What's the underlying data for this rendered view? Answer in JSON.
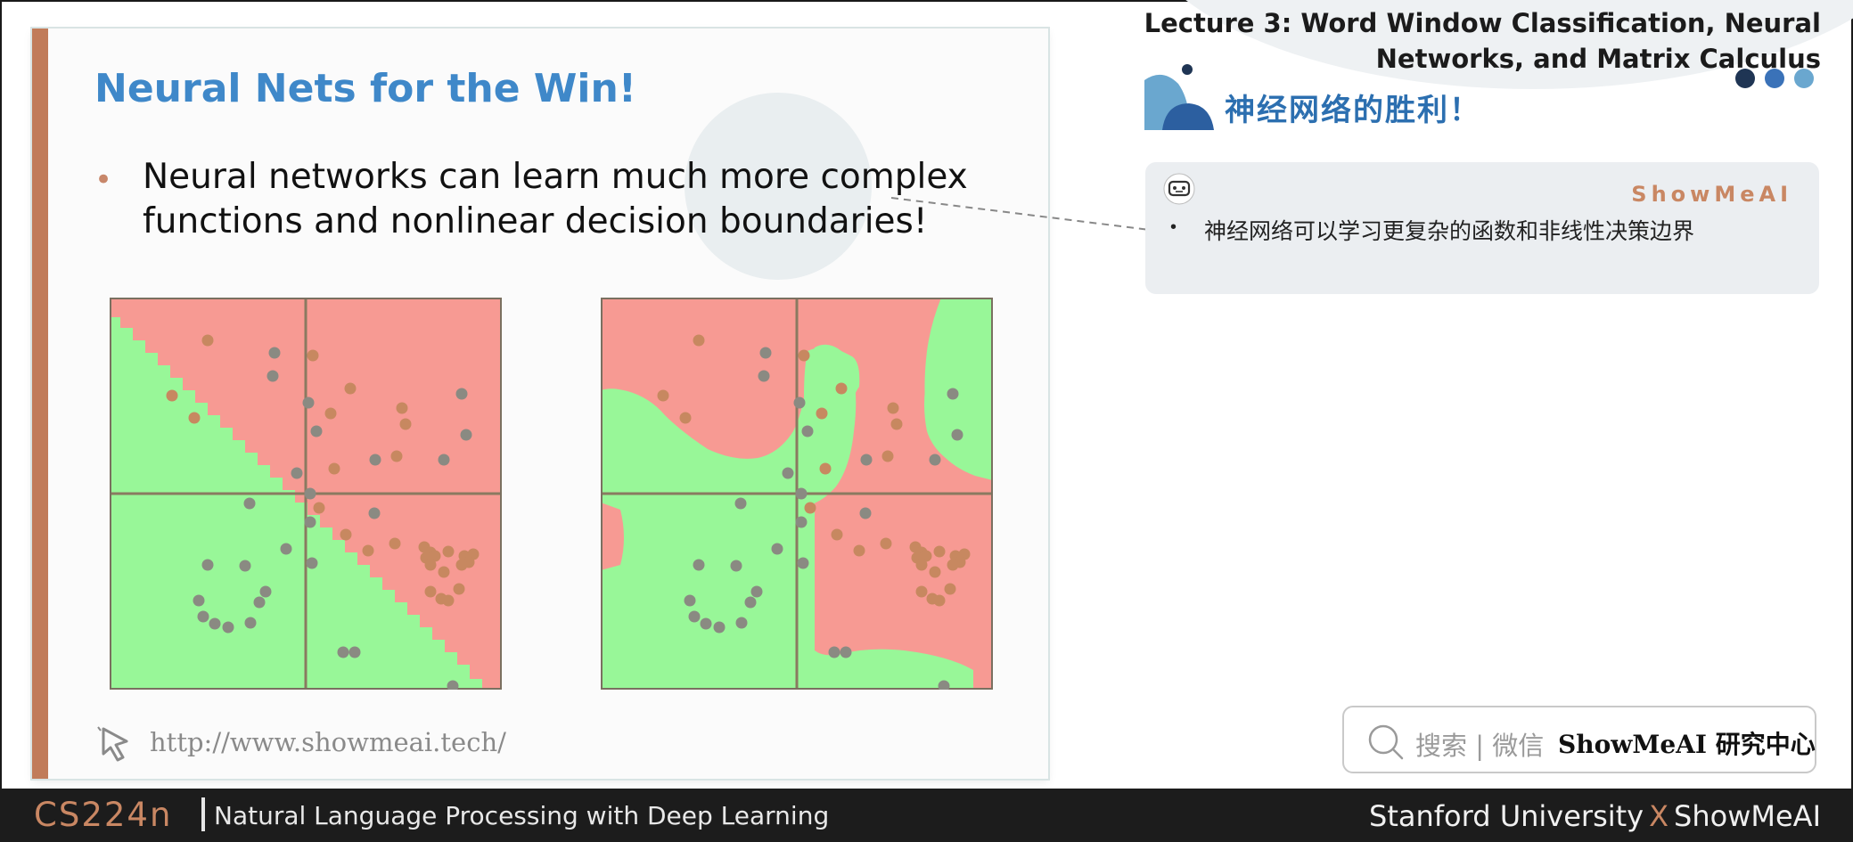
{
  "slide": {
    "title": "Neural Nets for the Win!",
    "bullet_marker": "•",
    "bullet_text": "Neural networks can learn much more complex functions and nonlinear decision boundaries!",
    "url": "http://www.showmeai.tech/"
  },
  "header": {
    "lecture_line1": "Lecture 3:  Word Window Classification, Neural",
    "lecture_line2": "Networks, and Matrix Calculus",
    "dot_colors": [
      "#1f3554",
      "#3a72b8",
      "#6aa7cf"
    ]
  },
  "section": {
    "title": "神经网络的胜利！"
  },
  "note": {
    "brand": "ShowMeAI",
    "bullet_marker": "•",
    "text": "神经网络可以学习更复杂的函数和非线性决策边界"
  },
  "search": {
    "hint": "搜索 | 微信",
    "brand": "ShowMeAI 研究中心"
  },
  "footer": {
    "course_code": "CS224n",
    "course_name": "Natural Language Processing with Deep Learning",
    "partner_left": "Stanford University",
    "partner_x": "X",
    "partner_right": "ShowMeAI"
  },
  "colors": {
    "accent_bar": "#c17c5a",
    "title_blue": "#3f88c9",
    "region_red": "#f79a93",
    "region_green": "#98f798",
    "point_orange": "#c78860",
    "point_gray": "#8a8a82",
    "footer_bg": "#1c1c1c"
  },
  "icons": [
    "cursor-click-icon",
    "robot-face-icon",
    "search-icon",
    "section-logo-icon"
  ]
}
